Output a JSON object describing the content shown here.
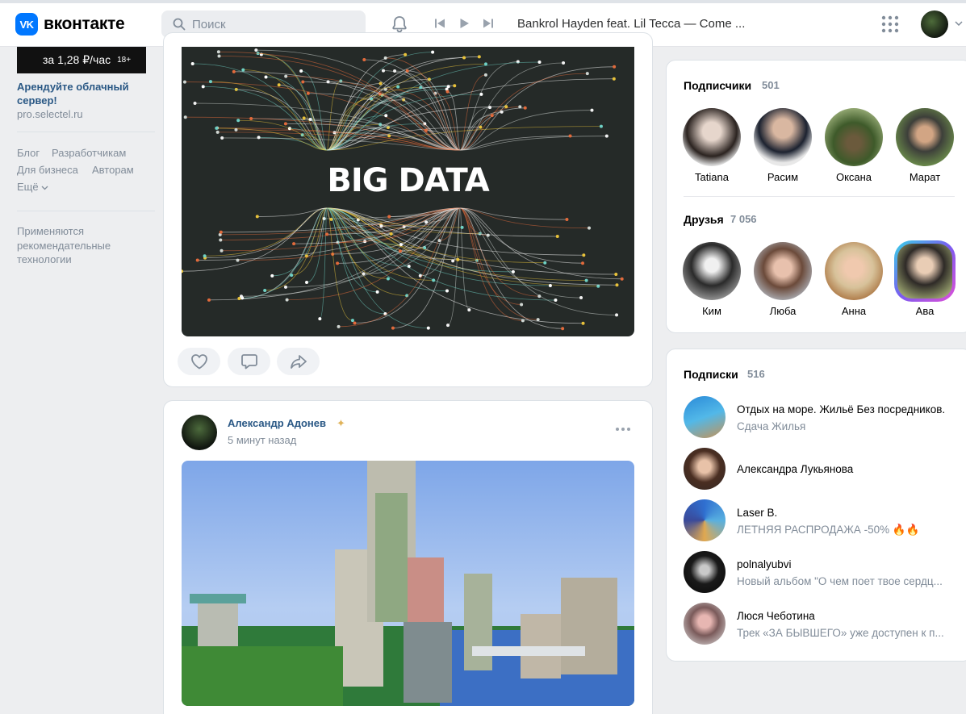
{
  "header": {
    "logo_mark": "VK",
    "logo_text": "вконтакте",
    "search_placeholder": "Поиск",
    "track_title": "Bankrol Hayden feat. Lil Tecca — Come ..."
  },
  "left": {
    "ad_banner_text": "за 1,28 ₽/час",
    "ad_badge": "18+",
    "ad_title": "Арендуйте облачный сервер!",
    "ad_url": "pro.selectel.ru",
    "links": [
      "Блог",
      "Разработчикам",
      "Для бизнеса",
      "Авторам",
      "Ещё"
    ],
    "note": "Применяются рекомендательные технологии"
  },
  "feed": {
    "post1_image_text": "BIG DATA",
    "post2": {
      "author": "Александр Адонев",
      "time": "5 минут назад"
    }
  },
  "subscribers": {
    "title": "Подписчики",
    "count": "501",
    "people": [
      "Tatiana",
      "Расим",
      "Оксана",
      "Марат"
    ]
  },
  "friends": {
    "title": "Друзья",
    "count": "7 056",
    "people": [
      "Ким",
      "Люба",
      "Анна",
      "Ава"
    ]
  },
  "subscriptions": {
    "title": "Подписки",
    "count": "516",
    "items": [
      {
        "name": "Отдых на море. Жильё Без посредников.",
        "sub": "Сдача Жилья"
      },
      {
        "name": "Александра Лукьянова",
        "sub": ""
      },
      {
        "name": "Laser B.",
        "sub": "ЛЕТНЯЯ РАСПРОДАЖА -50% 🔥🔥"
      },
      {
        "name": "polnalyubvi",
        "sub": "Новый альбом \"О чем поет твое сердц..."
      },
      {
        "name": "Люся Чеботина",
        "sub": "Трек «ЗА БЫВШЕГО» уже доступен к п..."
      }
    ]
  }
}
